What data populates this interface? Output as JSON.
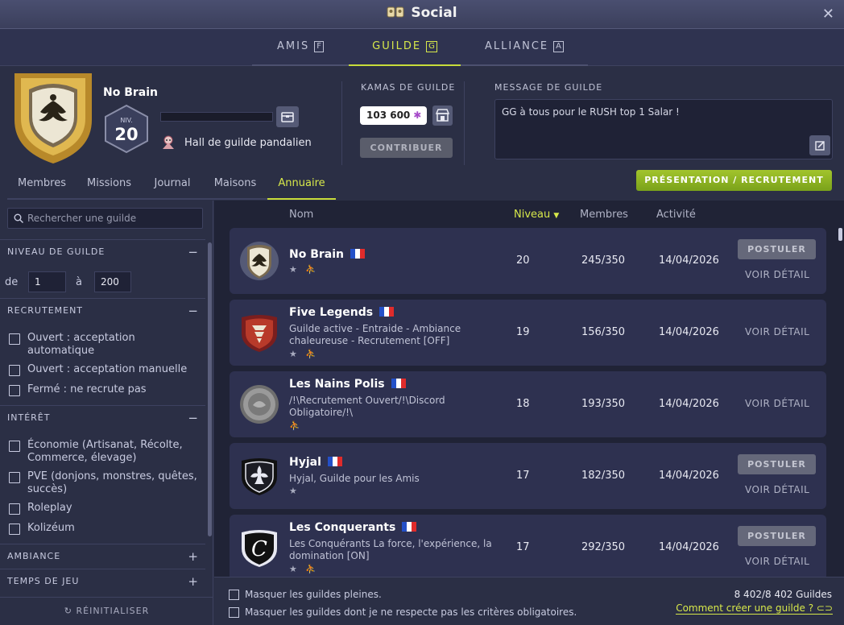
{
  "window": {
    "title": "Social",
    "close": "✕"
  },
  "top_tabs": [
    {
      "label": "AMIS",
      "key": "F"
    },
    {
      "label": "GUILDE",
      "key": "G"
    },
    {
      "label": "ALLIANCE",
      "key": "A"
    }
  ],
  "guild": {
    "name": "No Brain",
    "level_label": "NIV.",
    "level": "20",
    "hall": "Hall de guilde pandalien"
  },
  "kamas": {
    "title": "KAMAS DE GUILDE",
    "value": "103 600",
    "contribute": "CONTRIBUER"
  },
  "message": {
    "title": "MESSAGE DE GUILDE",
    "text": "GG à tous pour le RUSH top 1 Salar !"
  },
  "sub_tabs": [
    "Membres",
    "Missions",
    "Journal",
    "Maisons",
    "Annuaire"
  ],
  "recruit_button": "PRÉSENTATION / RECRUTEMENT",
  "sidebar": {
    "search_placeholder": "Rechercher une guilde",
    "level_section": "NIVEAU DE GUILDE",
    "from_label": "de",
    "from_value": "1",
    "to_label": "à",
    "to_value": "200",
    "recruit_section": "RECRUTEMENT",
    "recruit_options": [
      "Ouvert : acceptation automatique",
      "Ouvert : acceptation manuelle",
      "Fermé : ne recrute pas"
    ],
    "interest_section": "INTÉRÊT",
    "interest_options": [
      "Économie (Artisanat, Récolte, Commerce, élevage)",
      "PVE (donjons, monstres, quêtes, succès)",
      "Roleplay",
      "Kolizéum"
    ],
    "ambiance_section": "AMBIANCE",
    "time_section": "TEMPS DE JEU",
    "reset": "RÉINITIALISER"
  },
  "columns": {
    "name": "Nom",
    "level": "Niveau",
    "members": "Membres",
    "activity": "Activité"
  },
  "guilds": [
    {
      "name": "No Brain",
      "desc": "",
      "level": "20",
      "members": "245/350",
      "activity": "14/04/2026",
      "postuler": "POSTULER",
      "detail": "VOIR DÉTAIL"
    },
    {
      "name": "Five Legends",
      "desc": "Guilde active - Entraide - Ambiance chaleureuse - Recrutement [OFF]",
      "level": "19",
      "members": "156/350",
      "activity": "14/04/2026",
      "postuler": "",
      "detail": "VOIR DÉTAIL"
    },
    {
      "name": "Les Nains Polis",
      "desc": "/!\\Recrutement Ouvert/!\\Discord Obligatoire/!\\",
      "level": "18",
      "members": "193/350",
      "activity": "14/04/2026",
      "postuler": "",
      "detail": "VOIR DÉTAIL"
    },
    {
      "name": "Hyjal",
      "desc": "Hyjal, Guilde pour les Amis",
      "level": "17",
      "members": "182/350",
      "activity": "14/04/2026",
      "postuler": "POSTULER",
      "detail": "VOIR DÉTAIL"
    },
    {
      "name": "Les Conquerants",
      "desc": "Les Conquérants  La force, l'expérience, la domination [ON]",
      "level": "17",
      "members": "292/350",
      "activity": "14/04/2026",
      "postuler": "POSTULER",
      "detail": "VOIR DÉTAIL"
    }
  ],
  "footer": {
    "hide_full": "Masquer les guildes pleines.",
    "hide_criteria": "Masquer les guildes dont je ne respecte pas les critères obligatoires.",
    "count": "8 402/8 402 Guildes",
    "howto": "Comment créer une guilde ?"
  },
  "colors": {
    "accent": "#d7e84a",
    "recruit_green": "#8fb423",
    "background": "#2b2f45"
  }
}
